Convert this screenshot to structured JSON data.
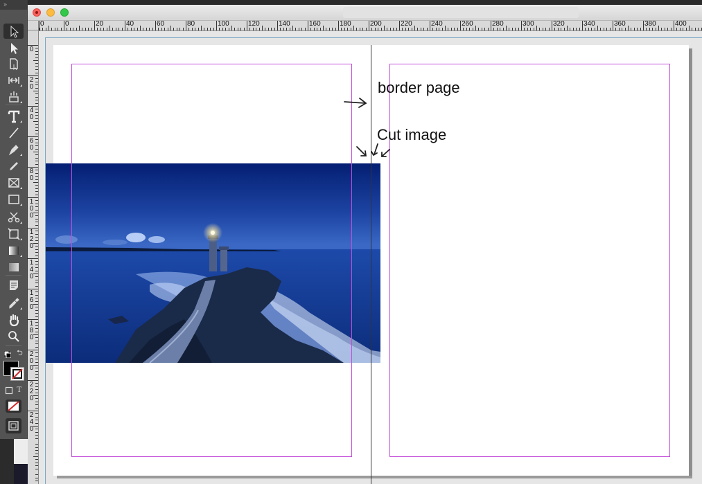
{
  "window": {
    "controls": {
      "close": "close-button",
      "minimize": "minimize-button",
      "maximize": "zoom-button"
    }
  },
  "ruler": {
    "horizontal_labels": [
      "0",
      "0",
      "20",
      "40",
      "60",
      "80",
      "100",
      "120",
      "140",
      "160",
      "180",
      "200",
      "220",
      "240",
      "260",
      "280",
      "300",
      "320",
      "340",
      "360",
      "380",
      "400"
    ],
    "vertical_labels": [
      "0",
      "2 0",
      "4 0",
      "6 0",
      "8 0",
      "1 0 0",
      "1 2 0",
      "1 4 0",
      "1 6 0",
      "1 8 0",
      "2 0 0",
      "2 2 0",
      "2 4 0"
    ]
  },
  "annotations": {
    "border_page": "border page",
    "cut_image": "Cut image"
  },
  "image": {
    "subject": "lighthouse-at-night",
    "colors": {
      "sky_top": "#05237a",
      "sky_horizon": "#2b56b5",
      "sea": "#163f9c",
      "rock": "#1b2a45",
      "light": "#fff6c8"
    }
  },
  "colors": {
    "margin_guide": "#c34dd9",
    "pasteboard": "#e6e6e6",
    "page": "#ffffff",
    "toolbar": "#535353",
    "fill_swatch": "#000000",
    "stroke_none": "#d22a2a"
  },
  "tools": [
    {
      "name": "selection-tool",
      "icon": "arrow-icon"
    },
    {
      "name": "direct-selection-tool",
      "icon": "white-arrow-icon"
    },
    {
      "name": "page-tool",
      "icon": "page-icon"
    },
    {
      "name": "gap-tool",
      "icon": "gap-icon"
    },
    {
      "name": "content-collector-tool",
      "icon": "collector-icon"
    },
    {
      "name": "type-tool",
      "icon": "type-icon"
    },
    {
      "name": "line-tool",
      "icon": "line-icon"
    },
    {
      "name": "pen-tool",
      "icon": "pen-icon"
    },
    {
      "name": "pencil-tool",
      "icon": "pencil-icon"
    },
    {
      "name": "rectangle-frame-tool",
      "icon": "frame-x-icon"
    },
    {
      "name": "rectangle-tool",
      "icon": "rectangle-icon"
    },
    {
      "name": "scissors-tool",
      "icon": "scissors-icon"
    },
    {
      "name": "free-transform-tool",
      "icon": "transform-icon"
    },
    {
      "name": "gradient-swatch-tool",
      "icon": "gradient-icon"
    },
    {
      "name": "gradient-feather-tool",
      "icon": "feather-icon"
    },
    {
      "name": "note-tool",
      "icon": "note-icon"
    },
    {
      "name": "eyedropper-tool",
      "icon": "eyedropper-icon"
    },
    {
      "name": "hand-tool",
      "icon": "hand-icon"
    },
    {
      "name": "zoom-tool",
      "icon": "zoom-icon"
    }
  ],
  "toolbar_bottom": {
    "format_text_label": "T"
  }
}
